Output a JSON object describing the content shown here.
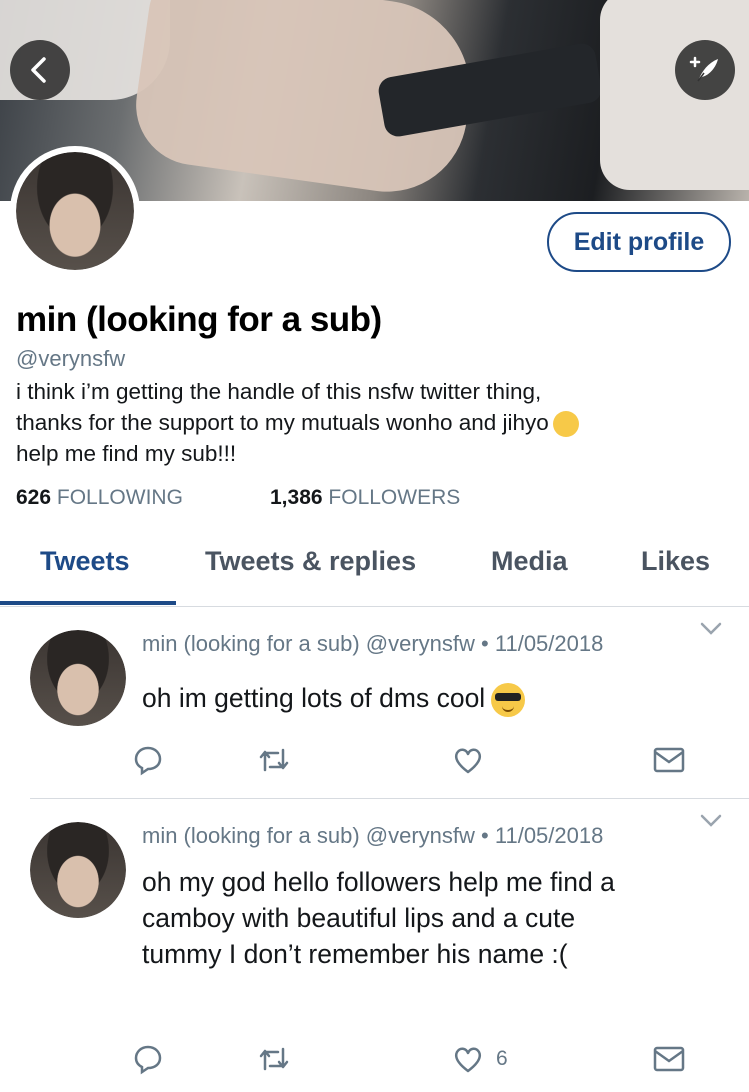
{
  "profile": {
    "name": "min (looking for a sub)",
    "handle": "@verynsfw",
    "bio_line1": "i think i’m getting the handle of this nsfw twitter thing,",
    "bio_line2": "thanks for the support to my mutuals wonho and jihyo",
    "bio_line3": "help me find my sub!!!",
    "bio_emoji": "sneezing-face",
    "following_count": "626",
    "following_label": "FOLLOWING",
    "followers_count": "1,386",
    "followers_label": "FOLLOWERS"
  },
  "header": {
    "edit_profile_label": "Edit profile"
  },
  "tabs": [
    {
      "label": "Tweets",
      "active": true
    },
    {
      "label": "Tweets & replies",
      "active": false
    },
    {
      "label": "Media",
      "active": false
    },
    {
      "label": "Likes",
      "active": false
    }
  ],
  "tweets": [
    {
      "author": "min (looking for a sub)",
      "handle": "@verynsfw",
      "date": "11/05/2018",
      "text": "oh im getting lots of dms cool",
      "emoji": "smiling-face-with-sunglasses",
      "likes": ""
    },
    {
      "author": "min (looking for a sub)",
      "handle": "@verynsfw",
      "date": "11/05/2018",
      "text_line1": "oh my god hello followers help me find a",
      "text_line2": "camboy with beautiful lips and a cute",
      "text_line3": "tummy I don’t remember his name :(",
      "likes": "6"
    }
  ],
  "colors": {
    "accent": "#1d4a87",
    "secondary_text": "#657786",
    "divider": "#d7dbe0"
  },
  "icons": {
    "back": "chevron-left-icon",
    "compose": "quill-sparkle-icon",
    "reply": "reply-bubble-icon",
    "retweet": "retweet-icon",
    "like": "heart-icon",
    "dm": "envelope-icon",
    "more": "chevron-down-icon"
  }
}
